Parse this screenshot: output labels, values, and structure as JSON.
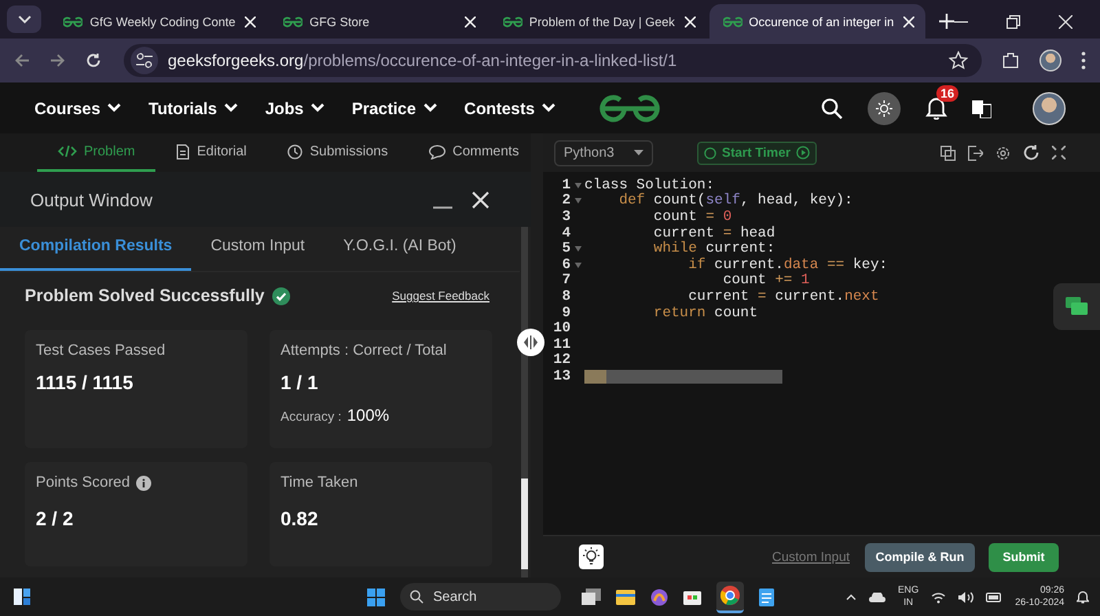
{
  "browser": {
    "tabs": [
      {
        "title": "GfG Weekly Coding Conte",
        "selected": false
      },
      {
        "title": "GFG Store",
        "selected": false
      },
      {
        "title": "Problem of the Day | Geek",
        "selected": false
      },
      {
        "title": "Occurence of an integer in",
        "selected": true
      }
    ],
    "url_domain": "geeksforgeeks.org",
    "url_path": "/problems/occurence-of-an-integer-in-a-linked-list/1"
  },
  "site_nav": {
    "items": [
      "Courses",
      "Tutorials",
      "Jobs",
      "Practice",
      "Contests"
    ],
    "notification_count": "16"
  },
  "problem_tabs": [
    {
      "label": "Problem",
      "kind": "code",
      "selected": true
    },
    {
      "label": "Editorial",
      "kind": "doc",
      "selected": false
    },
    {
      "label": "Submissions",
      "kind": "clock",
      "selected": false
    },
    {
      "label": "Comments",
      "kind": "chat",
      "selected": false
    }
  ],
  "output_window": {
    "title": "Output Window",
    "tabs": [
      {
        "label": "Compilation Results",
        "selected": true
      },
      {
        "label": "Custom Input",
        "selected": false
      },
      {
        "label": "Y.O.G.I. (AI Bot)",
        "selected": false
      }
    ],
    "status": "Problem Solved Successfully",
    "solved": true,
    "feedback_link": "Suggest Feedback",
    "cards": [
      {
        "label": "Test Cases Passed",
        "value": "1115 / 1115",
        "info": false
      },
      {
        "label": "Attempts : Correct / Total",
        "value": "1 / 1",
        "info": false,
        "extra_label": "Accuracy :",
        "extra_value": "100%"
      },
      {
        "label": "Points Scored",
        "value": "2 / 2",
        "info": true
      },
      {
        "label": "Time Taken",
        "value": "0.82",
        "info": false
      }
    ]
  },
  "editor": {
    "language": "Python3",
    "timer_button": "Start Timer",
    "lines": [
      {
        "number": "1",
        "foldable": true,
        "tokens": [
          {
            "text": "class Solution:",
            "kind": "plain"
          }
        ]
      },
      {
        "number": "2",
        "foldable": true,
        "tokens": [
          {
            "text": "    def",
            "kind": "keyword"
          },
          {
            "text": " count(",
            "kind": "plain"
          },
          {
            "text": "self",
            "kind": "self"
          },
          {
            "text": ", head, key):",
            "kind": "plain"
          }
        ]
      },
      {
        "number": "3",
        "foldable": false,
        "tokens": [
          {
            "text": "        count ",
            "kind": "plain"
          },
          {
            "text": "= ",
            "kind": "operator"
          },
          {
            "text": "0",
            "kind": "number"
          }
        ]
      },
      {
        "number": "4",
        "foldable": false,
        "tokens": [
          {
            "text": "        current ",
            "kind": "plain"
          },
          {
            "text": "=",
            "kind": "operator"
          },
          {
            "text": " head",
            "kind": "plain"
          }
        ]
      },
      {
        "number": "5",
        "foldable": true,
        "tokens": [
          {
            "text": "        while",
            "kind": "keyword"
          },
          {
            "text": " current:",
            "kind": "plain"
          }
        ]
      },
      {
        "number": "6",
        "foldable": true,
        "tokens": [
          {
            "text": "            if",
            "kind": "keyword"
          },
          {
            "text": " current.",
            "kind": "plain"
          },
          {
            "text": "data",
            "kind": "attribute"
          },
          {
            "text": " == ",
            "kind": "operator"
          },
          {
            "text": "key:",
            "kind": "plain"
          }
        ]
      },
      {
        "number": "7",
        "foldable": false,
        "tokens": [
          {
            "text": "                count ",
            "kind": "plain"
          },
          {
            "text": "+= ",
            "kind": "operator"
          },
          {
            "text": "1",
            "kind": "number"
          }
        ]
      },
      {
        "number": "8",
        "foldable": false,
        "tokens": [
          {
            "text": "            current ",
            "kind": "plain"
          },
          {
            "text": "=",
            "kind": "operator"
          },
          {
            "text": " current.",
            "kind": "plain"
          },
          {
            "text": "next",
            "kind": "attribute"
          }
        ]
      },
      {
        "number": "9",
        "foldable": false,
        "tokens": [
          {
            "text": "        return",
            "kind": "keyword"
          },
          {
            "text": " count",
            "kind": "plain"
          }
        ]
      },
      {
        "number": "10",
        "foldable": false
      },
      {
        "number": "11",
        "foldable": false
      },
      {
        "number": "12",
        "foldable": false
      },
      {
        "number": "13",
        "foldable": false,
        "selection": true
      }
    ],
    "custom_input_link": "Custom Input",
    "compile_button": "Compile & Run",
    "submit_button": "Submit"
  },
  "taskbar": {
    "search_placeholder": "Search",
    "language": "ENG",
    "region": "IN",
    "time": "09:26",
    "date": "26-10-2024"
  }
}
